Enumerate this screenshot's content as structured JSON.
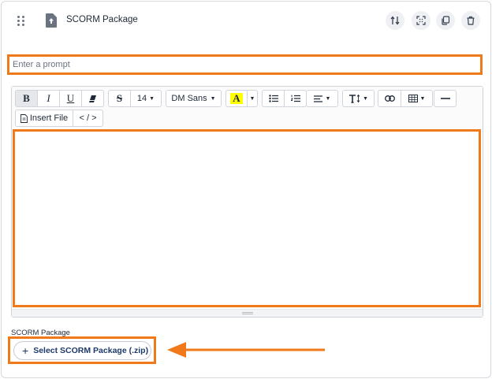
{
  "block": {
    "title": "SCORM Package",
    "header_icons": [
      "swap-icon",
      "expand-icon",
      "duplicate-icon",
      "trash-icon"
    ]
  },
  "prompt": {
    "placeholder": "Enter a prompt",
    "value": ""
  },
  "toolbar": {
    "bold": "B",
    "italic": "I",
    "underline": "U",
    "strike": "S",
    "font_size": "14",
    "font_family": "DM Sans",
    "text_color_label": "A",
    "insert_file": "Insert File",
    "code_view": "< / >"
  },
  "upload": {
    "label": "SCORM Package",
    "button": "Select SCORM Package (.zip)",
    "plus": "+"
  },
  "colors": {
    "annotation": "#f07a1a",
    "button_text": "#1e3a6b",
    "highlight": "#ffff00"
  }
}
